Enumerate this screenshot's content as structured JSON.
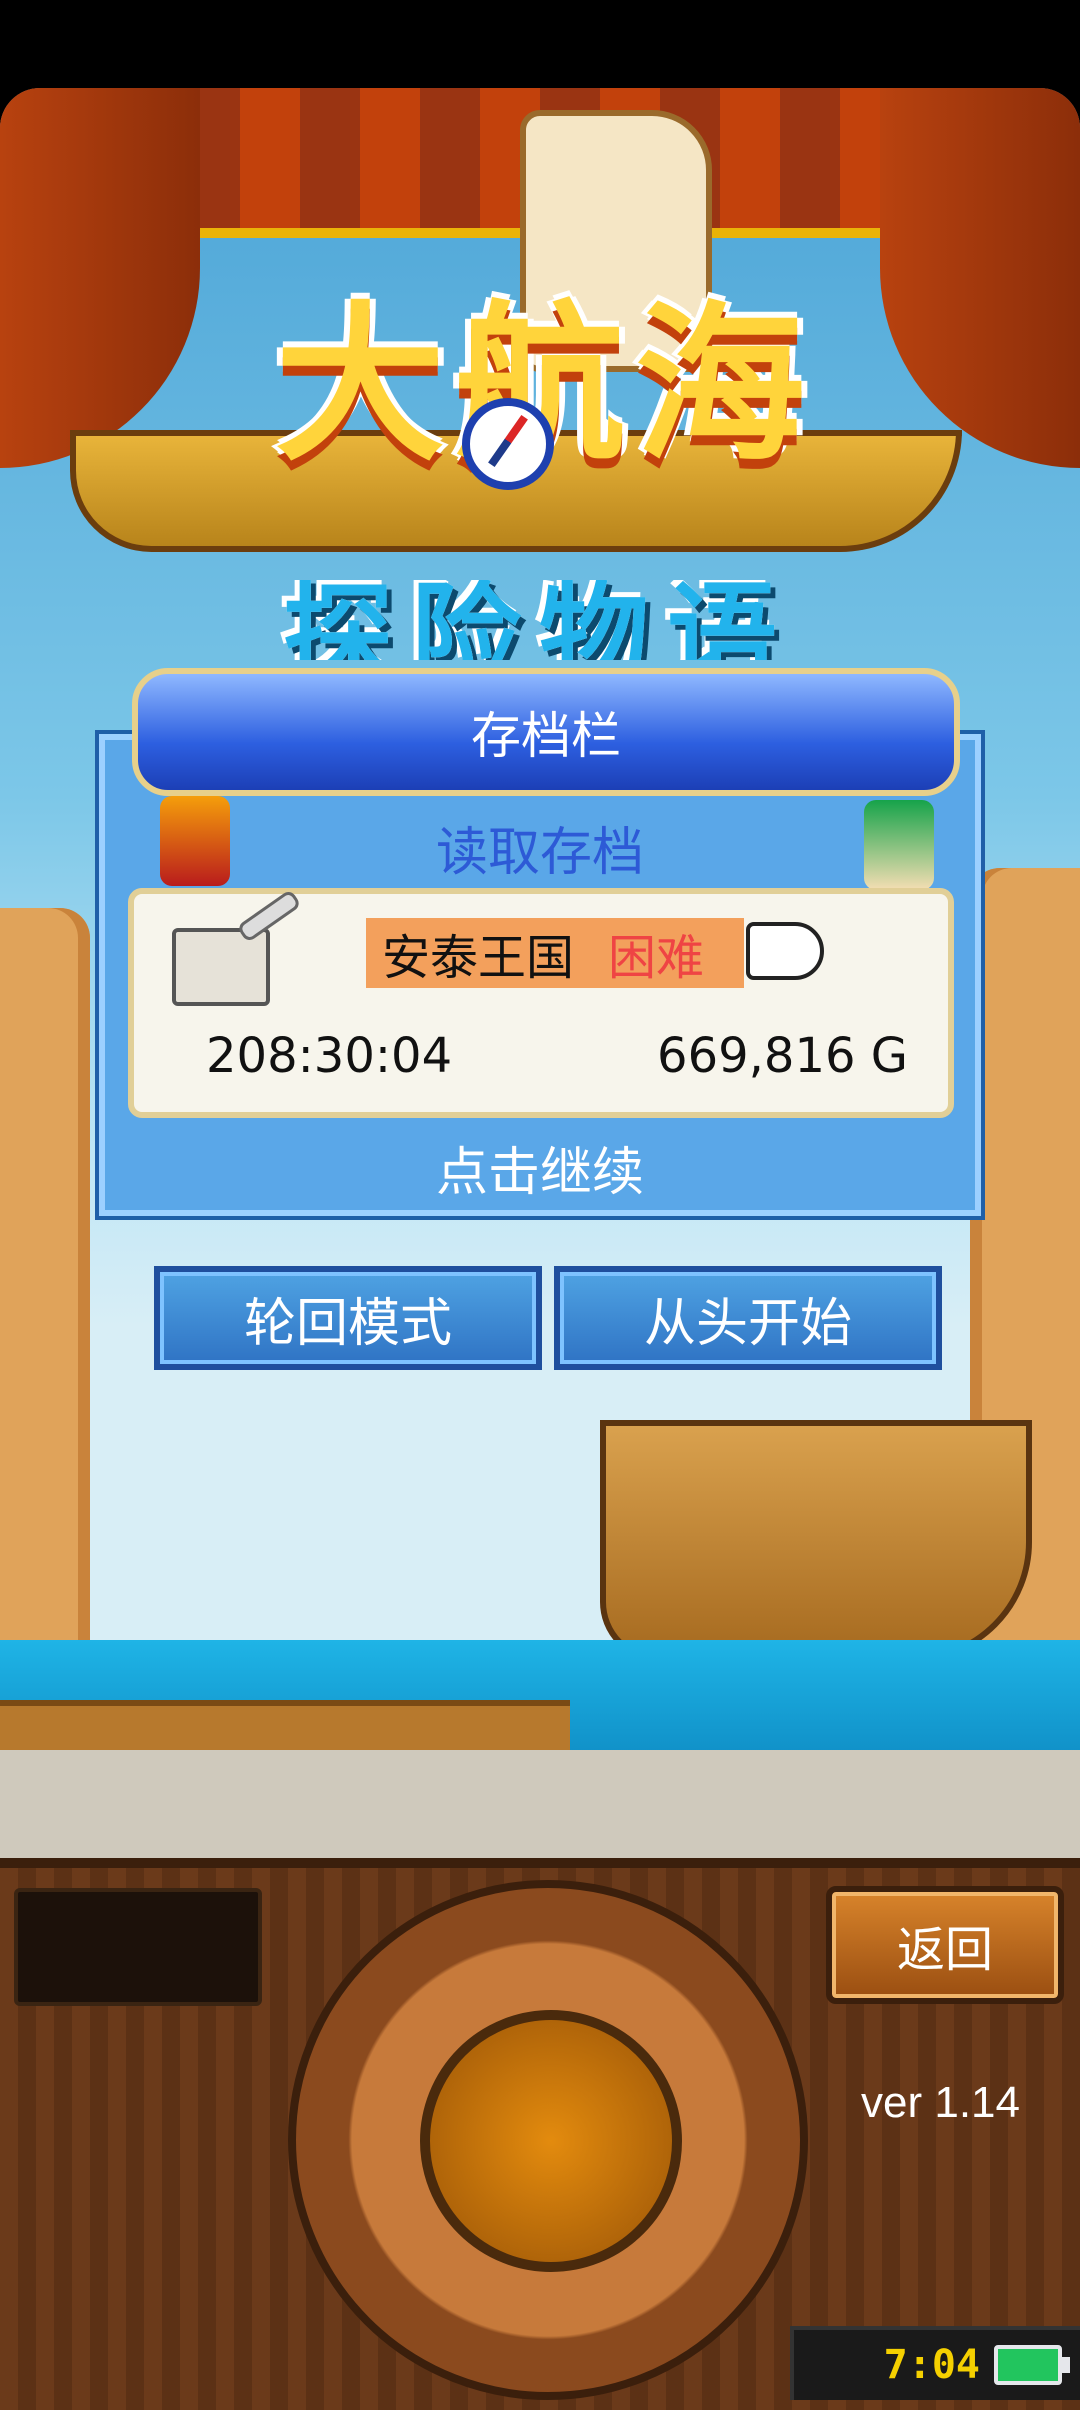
{
  "logo": {
    "title_chars": [
      "大",
      "航",
      "海"
    ],
    "subtitle_chars": [
      "探",
      "险",
      "物",
      "语"
    ]
  },
  "save_panel": {
    "header": "存档栏",
    "subtitle": "读取存档",
    "slot": {
      "kingdom": "安泰王国",
      "difficulty": "困难",
      "playtime": "208:30:04",
      "gold": "669,816 G"
    },
    "continue_label": "点击继续"
  },
  "mode_buttons": {
    "rebirth": "轮回模式",
    "new_game": "从头开始"
  },
  "console": {
    "back_label": "返回",
    "version": "ver 1.14",
    "clock": "7:04"
  },
  "icons": {
    "book": "book-quill-icon",
    "pointer": "pointing-hand-icon",
    "battery": "battery-icon",
    "compass": "compass-icon"
  }
}
